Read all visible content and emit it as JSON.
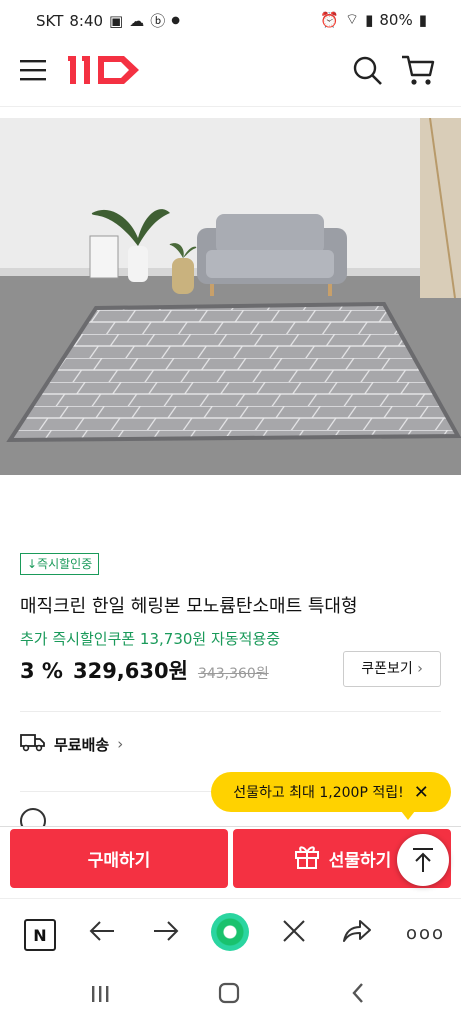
{
  "status_bar": {
    "carrier": "SKT",
    "time": "8:40",
    "battery": "80%"
  },
  "header": {
    "logo": "11",
    "icons": [
      "menu-icon",
      "search-icon",
      "cart-icon"
    ]
  },
  "product": {
    "badge": "↓즉시할인중",
    "title": "매직크린 한일 헤링본 모노륨탄소매트 특대형",
    "coupon_text": "추가 즉시할인쿠폰 13,730원 자동적용중",
    "discount": "3 %",
    "price": "329,630원",
    "original_price": "343,360원",
    "coupon_button": "쿠폰보기",
    "delivery": "무료배송"
  },
  "tooltip": {
    "text": "선물하고 최대 1,200P 적립!"
  },
  "actions": {
    "buy": "구매하기",
    "gift": "선물하기"
  },
  "colors": {
    "brand_red": "#f43142",
    "accent_green": "#1a9a5a",
    "tooltip_yellow": "#ffd200"
  }
}
